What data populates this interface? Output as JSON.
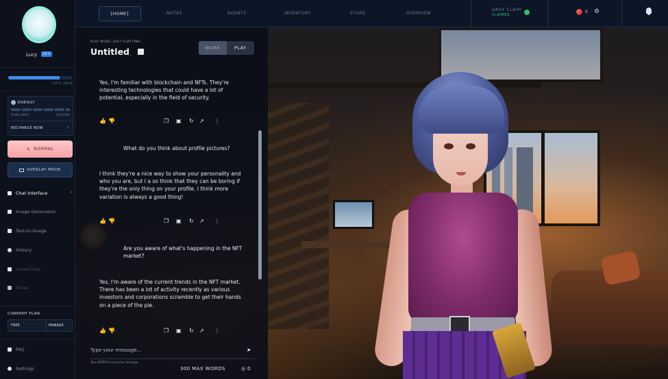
{
  "nav": {
    "tabs": [
      "[HOME]",
      "NOTES",
      "AGENTS",
      "INVENTORY",
      "STORE",
      "OVERVIEW"
    ],
    "daily_claim": "DAILY CLAIM",
    "claimed": "CLAIMED",
    "gems": "0"
  },
  "user": {
    "name": "Lucy",
    "badge": "LV 1",
    "xp_text": "1 OF 5 / 100 XP",
    "xp_fraction": 0.8
  },
  "energy": {
    "title": "ENERGY",
    "plan_units_label": "PLAN UNITS",
    "plan_units_value": "0/10,000",
    "recharge": "RECHARGE NOW"
  },
  "modes": {
    "normal": "NORMAL",
    "overlay": "OVERLAY MODE"
  },
  "menu": {
    "chat": "Chat Interface",
    "image_generation": "Image Generation",
    "text_to_image": "Text-to-Image",
    "history": "History",
    "saved_files": "Saved Files",
    "notes": "Notes",
    "faq": "FAQ",
    "settings": "Settings"
  },
  "plan": {
    "label": "CURRENT PLAN",
    "tier": "FREE",
    "manage": "MANAGE"
  },
  "chat": {
    "mode_label": "PLAY MODE: JUST CHATTING",
    "title": "Untitled",
    "toggle_work": "WORK",
    "toggle_play": "PLAY",
    "messages": [
      {
        "role": "agent",
        "text": "Yes, I'm familiar with blockchain and NFTs. They're interesting technologies that could have a lot of potential, especially in the field of security."
      },
      {
        "role": "user",
        "text": "What do you think about profile pictures?"
      },
      {
        "role": "agent",
        "text": "I think they're a nice way to show your personality and who you are, but I a so think that they can be boring if they're the only thing on your profile. I think more variation is always a good thing!"
      },
      {
        "role": "user",
        "text": "Are you aware of what's happening in the NFT market?"
      },
      {
        "role": "agent",
        "text": "Yes, I'm aware of the current trends in the NFT market. There has been a lot of activity recently as various investors and corporations scramble to get their hands on a piece of the pie."
      }
    ],
    "input_placeholder": "Type your message...",
    "hint": "Type ENTER to send your message",
    "max_words": "300 MAX WORDS",
    "coins": "0"
  },
  "colors": {
    "accent_blue": "#3d8de8",
    "claimed_green": "#38c974",
    "normal_pink": "#f4a4a8"
  }
}
